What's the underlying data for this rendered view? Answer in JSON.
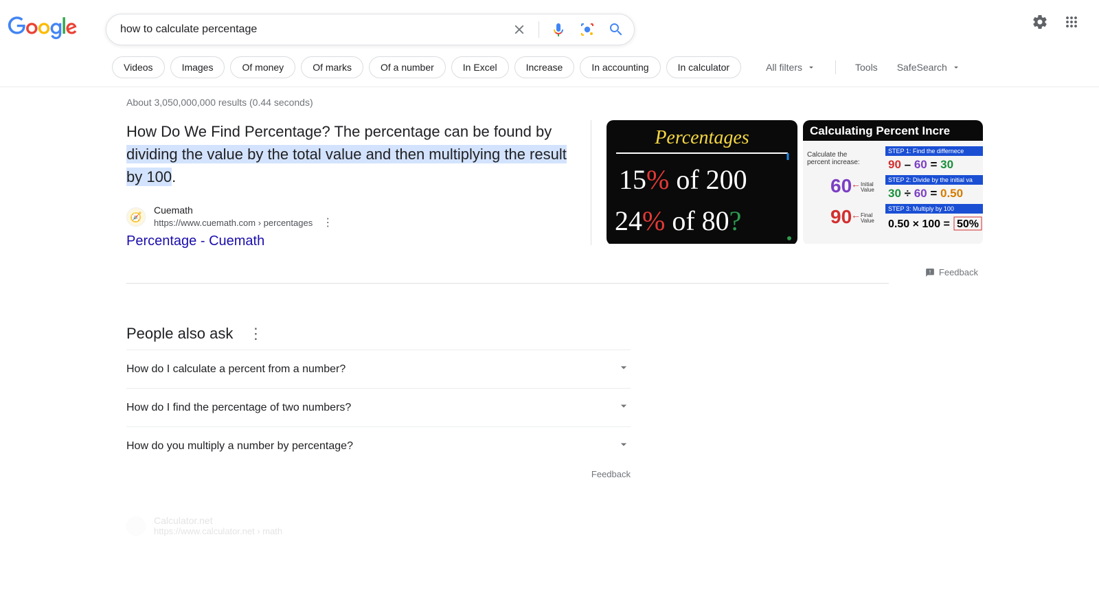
{
  "search": {
    "query": "how to calculate percentage"
  },
  "chips": [
    "Videos",
    "Images",
    "Of money",
    "Of marks",
    "Of a number",
    "In Excel",
    "Increase",
    "In accounting",
    "In calculator"
  ],
  "tools": {
    "all_filters": "All filters",
    "tools": "Tools",
    "safesearch": "SafeSearch"
  },
  "stats": "About 3,050,000,000 results (0.44 seconds)",
  "featured": {
    "prefix": "How Do We Find Percentage? The percentage can be found by ",
    "highlight": "dividing the value by the total value and then multiplying the result by 100",
    "suffix": ".",
    "source_name": "Cuemath",
    "source_url": "https://www.cuemath.com › percentages",
    "title": "Percentage - Cuemath"
  },
  "feedback": "Feedback",
  "paa": {
    "header": "People also ask",
    "items": [
      "How do I calculate a percent from a number?",
      "How do I find the percentage of two numbers?",
      "How do you multiply a number by percentage?"
    ],
    "feedback": "Feedback"
  },
  "thumbnails": {
    "card1": {
      "title": "Percentages",
      "line1a": "15",
      "line1b": "%",
      "line1c": " of ",
      "line1d": "200",
      "line2a": "24",
      "line2b": "%",
      "line2c": " of ",
      "line2d": " 80",
      "line2e": "?"
    },
    "card2": {
      "title": "Calculating Percent Incre",
      "sub": "Calculate the percent increase:",
      "v1": "60",
      "v1lbl": "Initial Value",
      "v2": "90",
      "v2lbl": "Final Value",
      "step1": "STEP 1:  Find the differnece",
      "eq1": "90 – 60 = 30",
      "step2": "STEP 2: Divide by the initial va",
      "eq2": "30 ÷ 60 = 0.50",
      "step3": "STEP 3: Multiply by 100",
      "eq3": "0.50 × 100 = 50%"
    }
  },
  "faded": {
    "name": "Calculator.net",
    "url": "https://www.calculator.net › math"
  }
}
